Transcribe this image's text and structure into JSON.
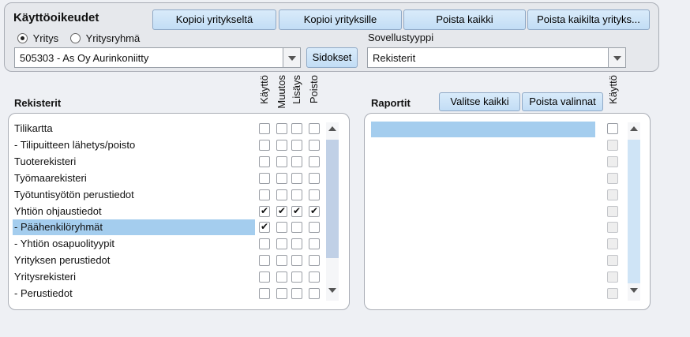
{
  "header": {
    "title": "Käyttöoikeudet",
    "buttons": [
      "Kopioi yritykseltä",
      "Kopioi yrityksille",
      "Poista kaikki",
      "Poista kaikilta yrityks..."
    ],
    "radio": {
      "company_label": "Yritys",
      "group_label": "Yritysryhmä",
      "selected": "Yritys"
    },
    "company_combo": {
      "value": "505303 - As Oy Aurinkoniitty"
    },
    "links_button": "Sidokset",
    "app_type_label": "Sovellustyyppi",
    "app_type_combo": {
      "value": "Rekisterit"
    }
  },
  "registers": {
    "title": "Rekisterit",
    "columns": [
      "Käyttö",
      "Muutos",
      "Lisäys",
      "Poisto"
    ],
    "selected_index": 6,
    "rows": [
      {
        "label": "Tilikartta",
        "checks": [
          false,
          false,
          false,
          false
        ]
      },
      {
        "label": "- Tilipuitteen lähetys/poisto",
        "checks": [
          false,
          false,
          false,
          false
        ]
      },
      {
        "label": "Tuoterekisteri",
        "checks": [
          false,
          false,
          false,
          false
        ]
      },
      {
        "label": "Työmaarekisteri",
        "checks": [
          false,
          false,
          false,
          false
        ]
      },
      {
        "label": "Työtuntisyötön perustiedot",
        "checks": [
          false,
          false,
          false,
          false
        ]
      },
      {
        "label": "Yhtiön ohjaustiedot",
        "checks": [
          true,
          true,
          true,
          true
        ]
      },
      {
        "label": "- Päähenkilöryhmät",
        "checks": [
          true,
          false,
          false,
          false
        ]
      },
      {
        "label": "- Yhtiön osapuolityypit",
        "checks": [
          false,
          false,
          false,
          false
        ]
      },
      {
        "label": "Yrityksen perustiedot",
        "checks": [
          false,
          false,
          false,
          false
        ]
      },
      {
        "label": "Yritysrekisteri",
        "checks": [
          false,
          false,
          false,
          false
        ]
      },
      {
        "label": "- Perustiedot",
        "checks": [
          false,
          false,
          false,
          false
        ]
      }
    ]
  },
  "reports": {
    "title": "Raportit",
    "select_all_button": "Valitse kaikki",
    "clear_selection_button": "Poista valinnat",
    "column": "Käyttö",
    "row_count": 11
  },
  "colors": {
    "selection": "#a4cdee",
    "button": "#c9e1f7",
    "scroll_thumb": "#c0d0e6"
  }
}
